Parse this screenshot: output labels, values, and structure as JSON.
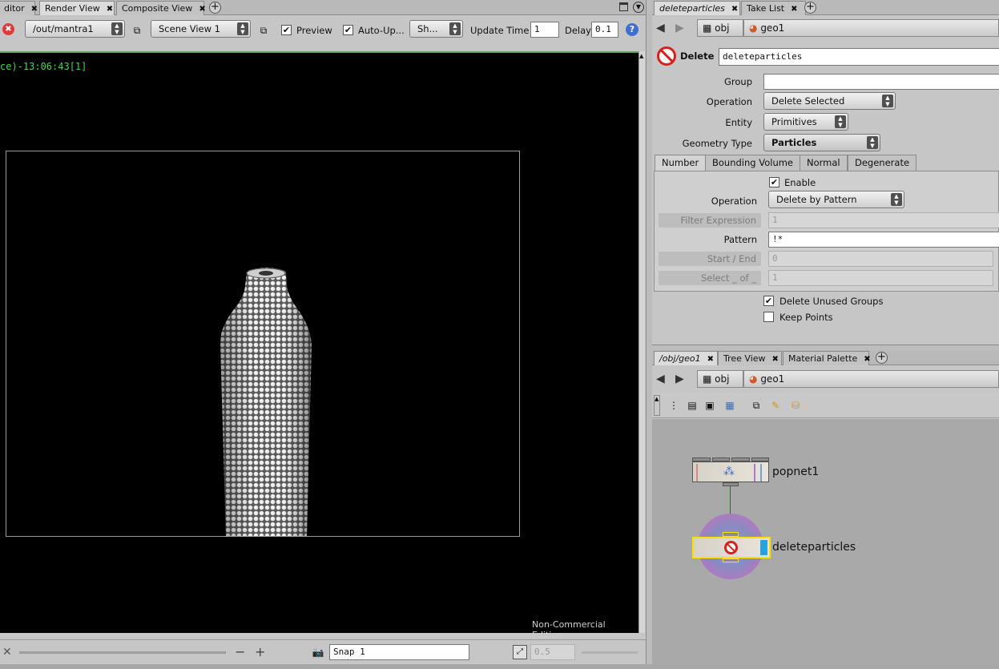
{
  "left_tabs": [
    {
      "label": "ditor",
      "active": false
    },
    {
      "label": "Render View",
      "active": true
    },
    {
      "label": "Composite View",
      "active": false
    }
  ],
  "right_top_tabs": [
    {
      "label": "deleteparticles",
      "active": true
    },
    {
      "label": "Take List",
      "active": false
    }
  ],
  "right_bottom_tabs": [
    {
      "label": "/obj/geo1",
      "active": true
    },
    {
      "label": "Tree View",
      "active": false
    },
    {
      "label": "Material Palette",
      "active": false
    }
  ],
  "render_toolbar": {
    "driver": "/out/mantra1",
    "camera": "Scene View 1",
    "preview_label": "Preview",
    "preview_checked": true,
    "autoupdate_label": "Auto-Up...",
    "autoupdate_checked": true,
    "shading": "Sh...",
    "update_time_label": "Update Time",
    "update_time_value": "1",
    "delay_label": "Delay",
    "delay_value": "0.1"
  },
  "render_view": {
    "stamp": "ce)-13:06:43[1]",
    "watermark": "Non-Commercial Edition"
  },
  "render_bottom": {
    "snap_value": "Snap  1",
    "zoom_value": "0.5"
  },
  "path_bar": {
    "root": "obj",
    "node": "geo1"
  },
  "params": {
    "node_type": "Delete",
    "node_name": "deleteparticles",
    "group_label": "Group",
    "group_value": "",
    "operation_label": "Operation",
    "operation_value": "Delete Selected",
    "entity_label": "Entity",
    "entity_value": "Primitives",
    "geometry_type_label": "Geometry Type",
    "geometry_type_value": "Particles",
    "tabs": [
      "Number",
      "Bounding Volume",
      "Normal",
      "Degenerate"
    ],
    "enable_label": "Enable",
    "enable_checked": true,
    "number_operation_label": "Operation",
    "number_operation_value": "Delete by Pattern",
    "filter_expression_label": "Filter Expression",
    "filter_expression_value": "1",
    "pattern_label": "Pattern",
    "pattern_value": "!*",
    "start_end_label": "Start / End",
    "start_end_value": "0",
    "select_of_label": "Select _ of _",
    "select_of_value": "1",
    "delete_unused_groups_label": "Delete Unused Groups",
    "delete_unused_groups_checked": true,
    "keep_points_label": "Keep Points",
    "keep_points_checked": false
  },
  "network": {
    "nodes": [
      {
        "name": "popnet1"
      },
      {
        "name": "deleteparticles"
      }
    ]
  },
  "colors": {
    "accent_green": "#4fd14f",
    "node_selected": "#ffe000",
    "display_flag": "#29a3e0"
  }
}
